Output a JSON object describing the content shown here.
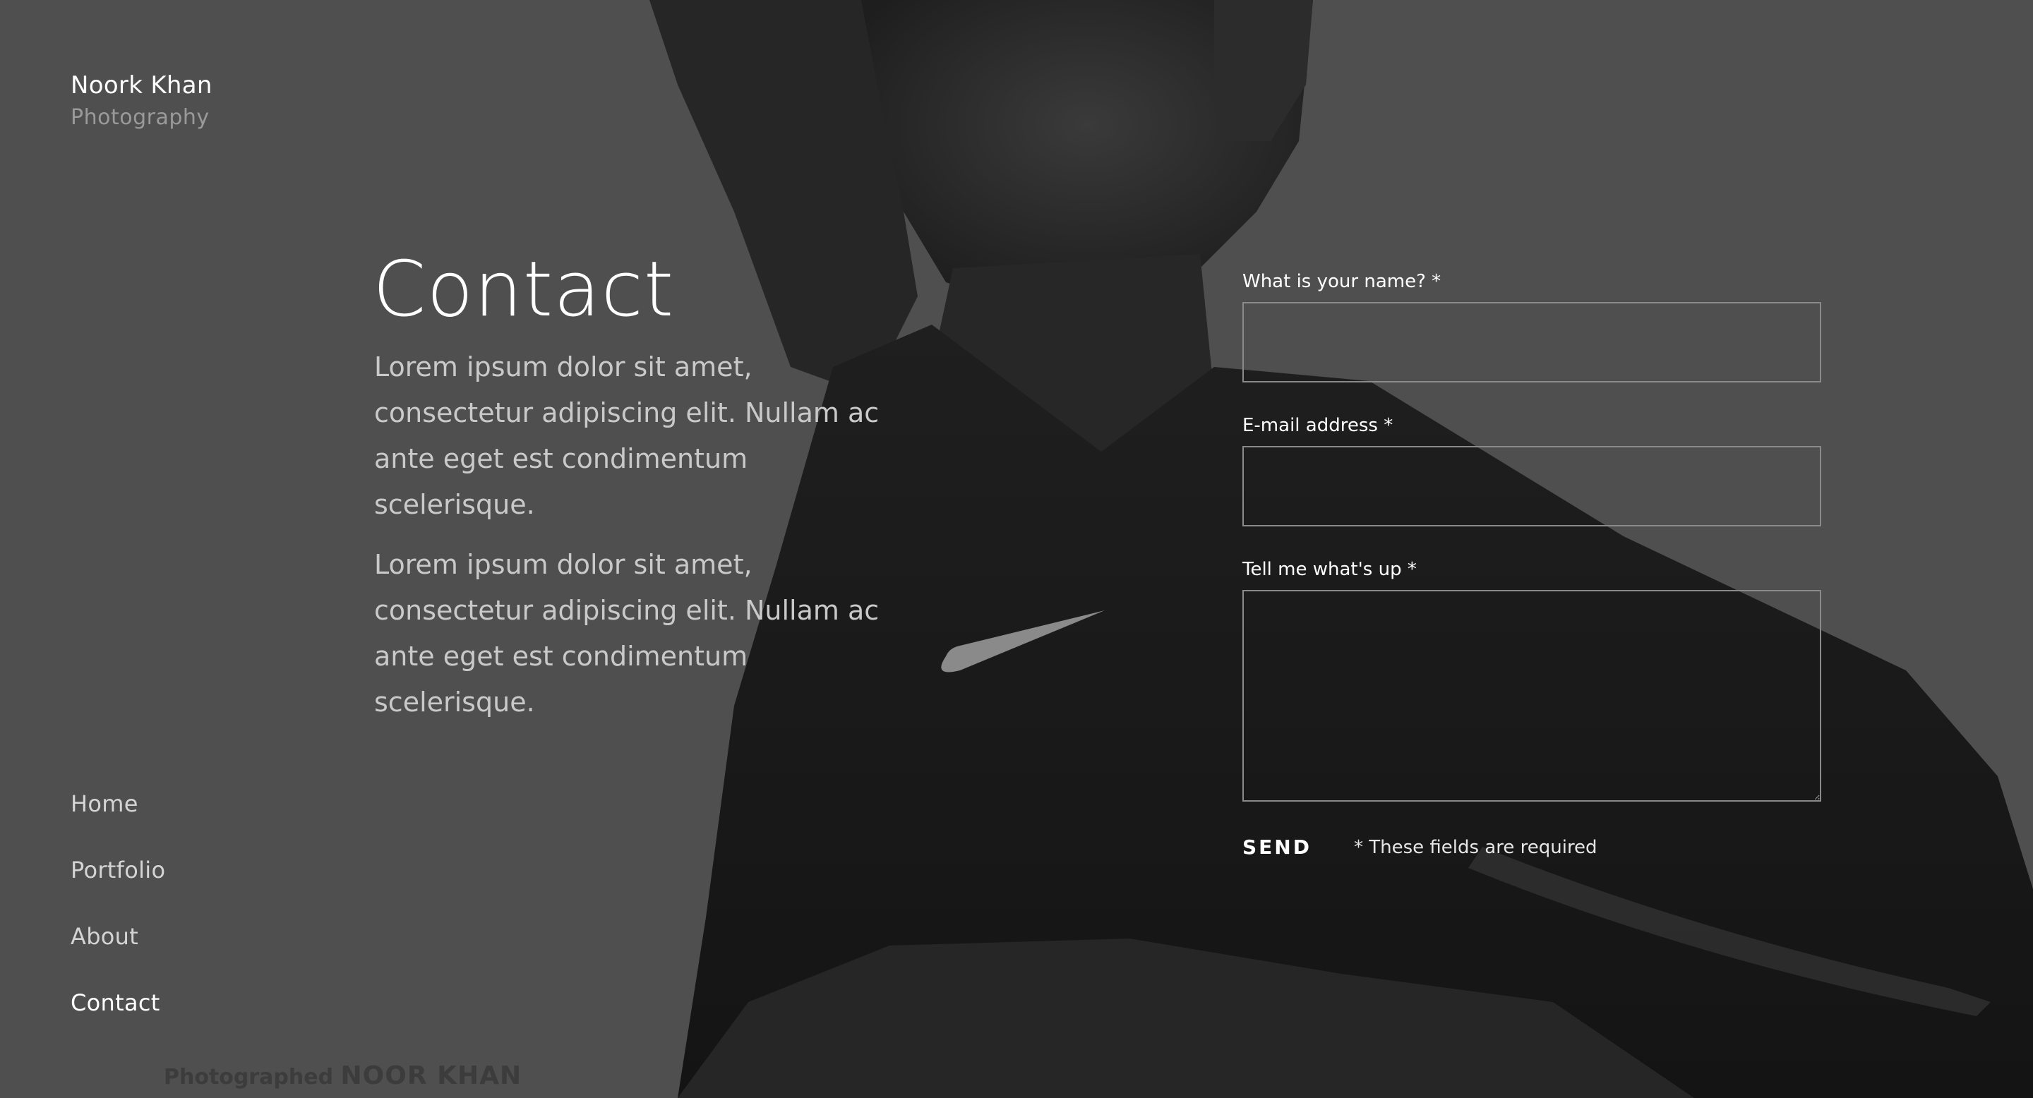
{
  "brand": {
    "name": "Noork Khan",
    "tagline": "Photography"
  },
  "main": {
    "title": "Contact",
    "paragraphs": [
      "Lorem ipsum dolor sit amet, consectetur adipiscing elit. Nullam ac ante eget est condimentum scelerisque.",
      "Lorem ipsum dolor sit amet, consectetur adipiscing elit. Nullam ac ante eget est condimentum scelerisque."
    ]
  },
  "form": {
    "name_label": "What is your name? *",
    "name_value": "",
    "email_label": "E-mail address *",
    "email_value": "",
    "message_label": "Tell me what's up *",
    "message_value": "",
    "send_label": "SEND",
    "required_note": "* These fields are required"
  },
  "nav": {
    "items": [
      {
        "label": "Home"
      },
      {
        "label": "Portfolio"
      },
      {
        "label": "About"
      },
      {
        "label": "Contact"
      }
    ],
    "active": "Contact"
  },
  "watermark": {
    "prefix": "Photographed",
    "name": "NOOR KHAN"
  },
  "colors": {
    "background": "#4f4f4f",
    "text": "#ffffff",
    "muted": "#9a9a9a",
    "input_border": "#8a8a8a"
  }
}
